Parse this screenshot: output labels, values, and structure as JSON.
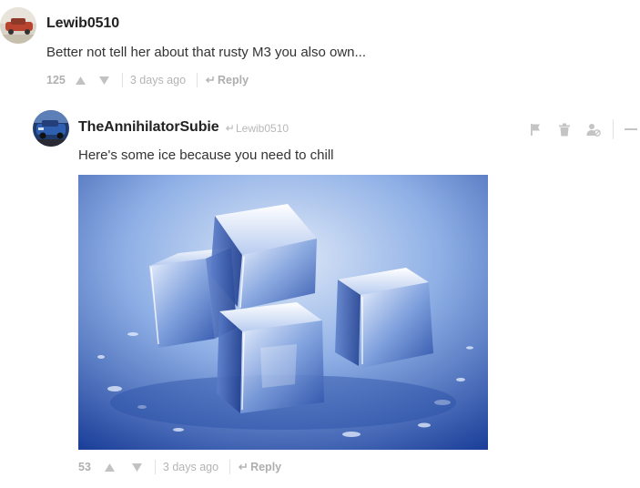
{
  "parent_comment": {
    "avatar": "car-avatar-red",
    "username": "Lewib0510",
    "text": "Better not tell her about that rusty M3 you also own...",
    "score": "125",
    "time": "3 days ago",
    "reply_label": "Reply"
  },
  "reply_comment": {
    "avatar": "car-avatar-blue",
    "username": "TheAnnihilatorSubie",
    "reply_to": "Lewib0510",
    "text": "Here's some ice because you need to chill",
    "image": "ice-cubes-photo",
    "score": "53",
    "time": "3 days ago",
    "reply_label": "Reply",
    "actions": [
      "flag-icon",
      "trash-icon",
      "block-user-icon",
      "collapse-icon"
    ]
  },
  "colors": {
    "meta_text": "#b4b4b4",
    "username": "#222222",
    "body": "#333333",
    "ice_blue": "#3a5fb5"
  }
}
